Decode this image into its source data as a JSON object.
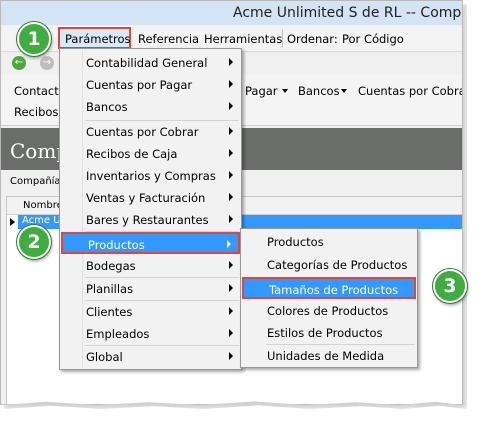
{
  "window": {
    "title": "Acme Unlimited S de RL -- Comp"
  },
  "menubar": {
    "items": [
      "Parámetros",
      "Referencia",
      "Herramientas",
      "Ordenar:",
      "Por Código"
    ]
  },
  "toolbar": {
    "row1": [
      "Contacto",
      "Pagar",
      "Bancos",
      "Cuentas por Cobrar"
    ],
    "row2": [
      "Recibos d"
    ]
  },
  "panel": {
    "title": "Comp",
    "section": "Compañía",
    "column": "Nombre",
    "row_text": "Acme Ul"
  },
  "menu_main": {
    "items": [
      {
        "label": "Contabilidad General"
      },
      {
        "label": "Cuentas por Pagar"
      },
      {
        "label": "Bancos"
      },
      {
        "label": "Cuentas por Cobrar"
      },
      {
        "label": "Recibos de Caja"
      },
      {
        "label": "Inventarios y Compras"
      },
      {
        "label": "Ventas y Facturación"
      },
      {
        "label": "Bares y Restaurantes"
      },
      {
        "label": "Productos"
      },
      {
        "label": "Bodegas"
      },
      {
        "label": "Planillas"
      },
      {
        "label": "Clientes"
      },
      {
        "label": "Empleados"
      },
      {
        "label": "Global"
      }
    ]
  },
  "menu_products": {
    "items": [
      {
        "label": "Productos"
      },
      {
        "label": "Categorías de Productos"
      },
      {
        "label": "Tamaños de Productos"
      },
      {
        "label": "Colores de Productos"
      },
      {
        "label": "Estilos de Productos"
      },
      {
        "label": "Unidades de Medida"
      }
    ]
  },
  "steps": [
    "1",
    "2",
    "3"
  ],
  "colors": {
    "highlight": "#3399ff",
    "callout_border": "#e0463c",
    "badge": "#3fae3f"
  }
}
